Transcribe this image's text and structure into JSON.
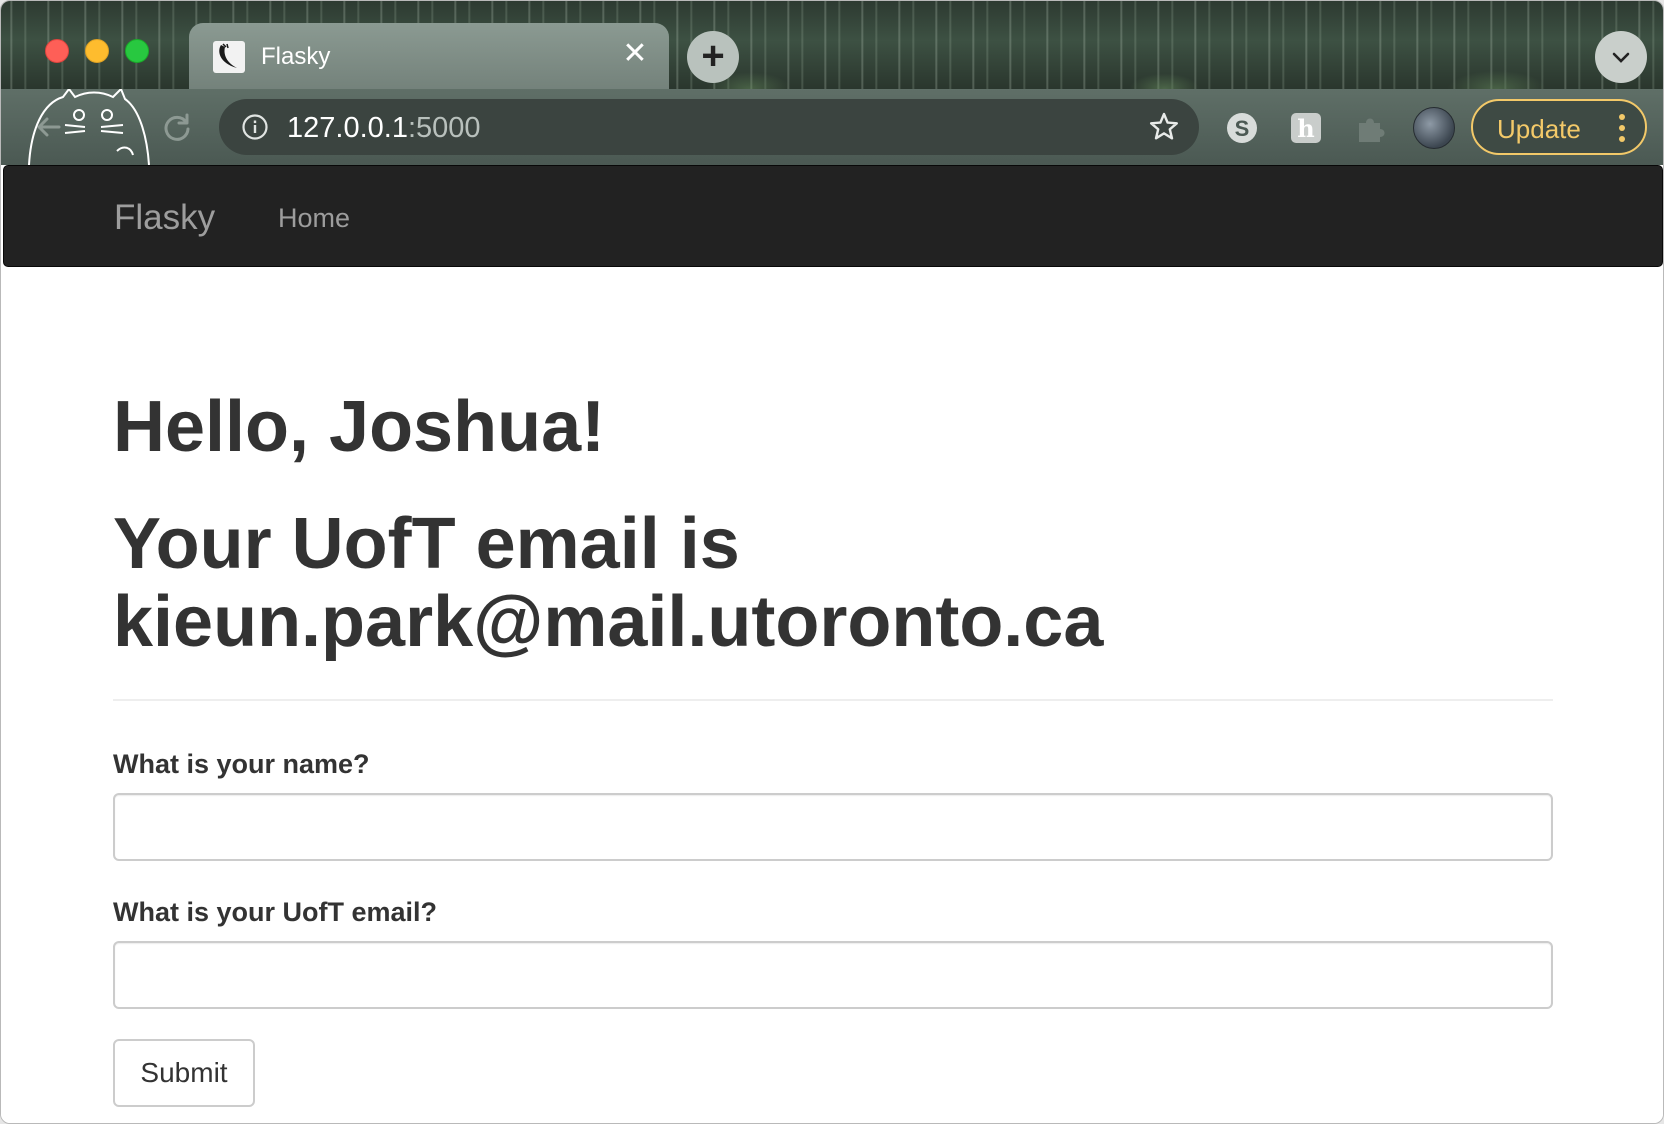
{
  "browser": {
    "tab": {
      "title": "Flasky",
      "close_glyph": "✕"
    },
    "new_tab_glyph": "+",
    "address_bar": {
      "host": "127.0.0.1",
      "port": ":5000"
    },
    "update_button_label": "Update",
    "icons": [
      "back-icon",
      "reload-icon",
      "site-info-icon",
      "star-icon",
      "skype-extension-icon",
      "hypothesis-extension-icon",
      "extensions-puzzle-icon",
      "kebab-menu-icon",
      "tab-search-icon"
    ],
    "colors": {
      "update_accent": "#f3c969",
      "toolbar": "#55645d"
    }
  },
  "navbar": {
    "brand": "Flasky",
    "links": [
      {
        "label": "Home"
      }
    ],
    "colors": {
      "background": "#222222",
      "link": "#9d9d9d"
    }
  },
  "main": {
    "greeting": "Hello, Joshua!",
    "email_heading": "Your UofT email is kieun.park@mail.utoronto.ca"
  },
  "form": {
    "name_field": {
      "label": "What is your name?",
      "value": "",
      "placeholder": ""
    },
    "email_field": {
      "label": "What is your UofT email?",
      "value": "",
      "placeholder": ""
    },
    "submit_label": "Submit"
  }
}
